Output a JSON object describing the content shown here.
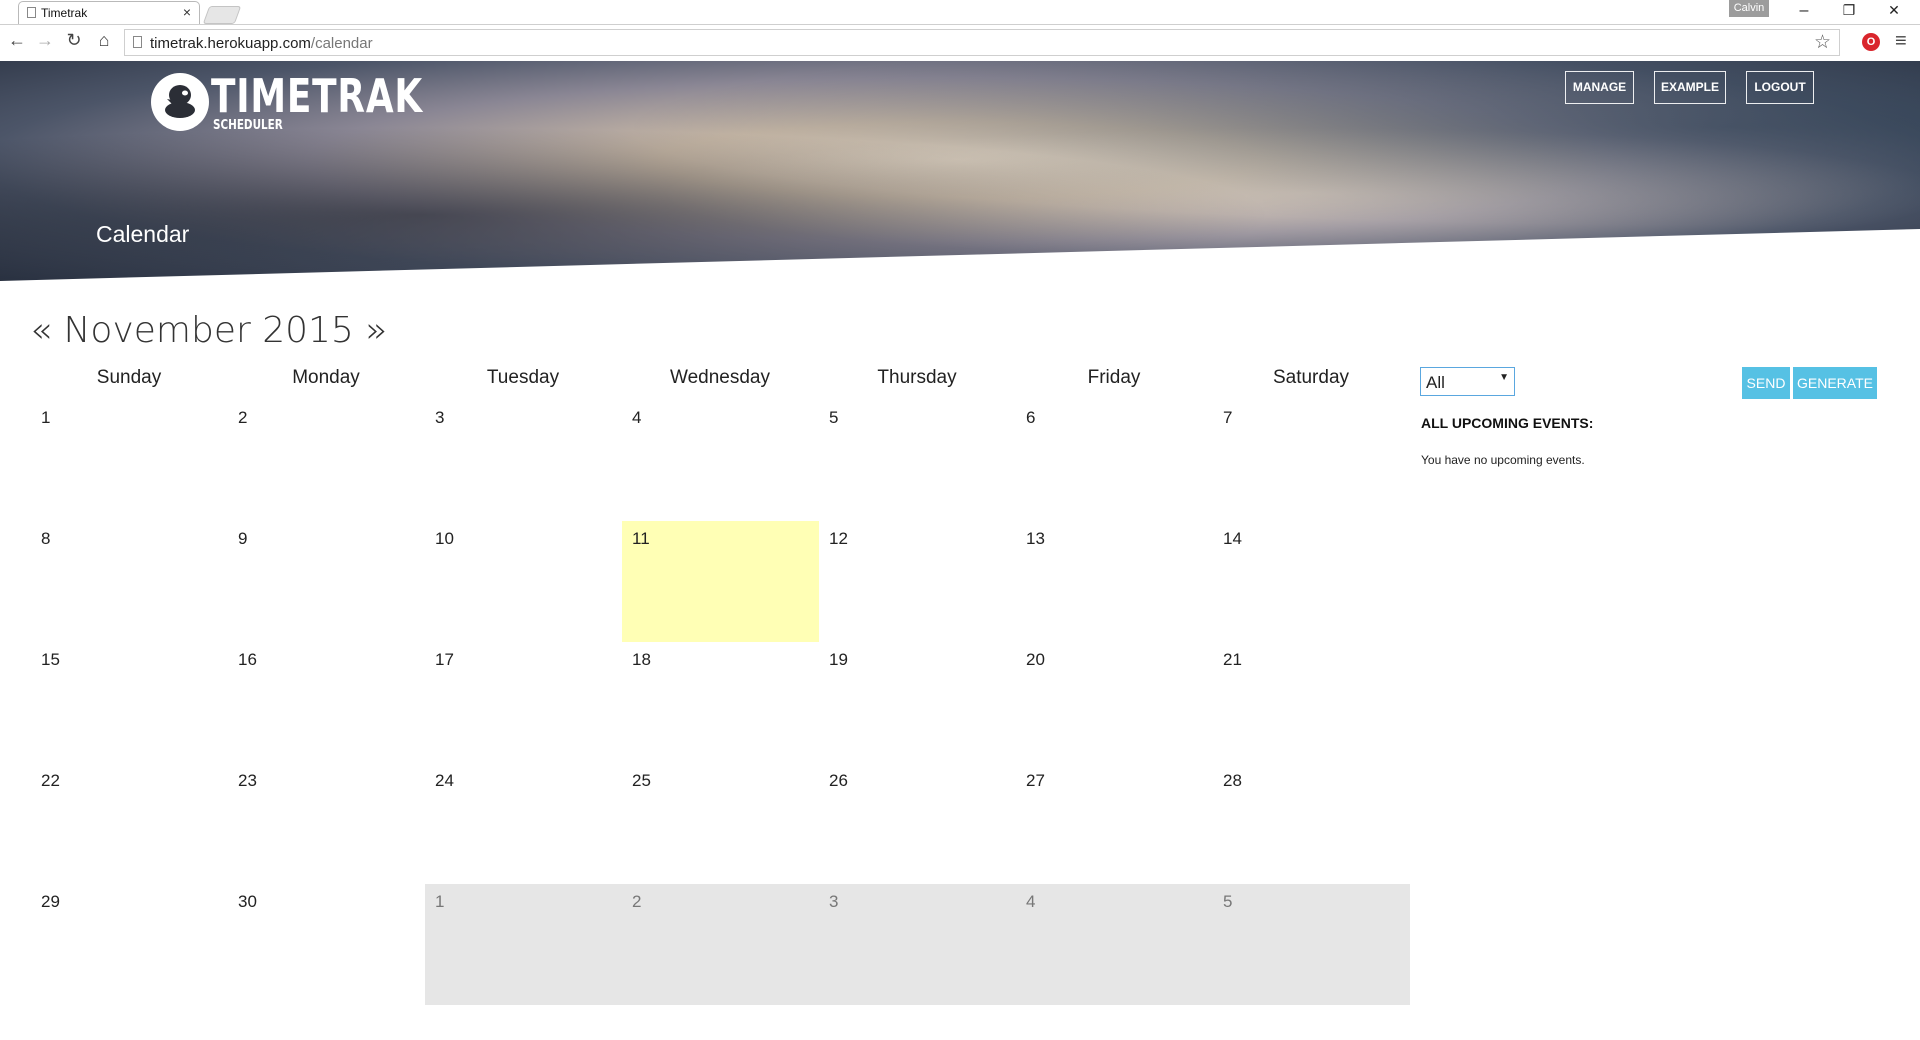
{
  "browser": {
    "tab_title": "Timetrak",
    "tab_close": "×",
    "profile_name": "Calvin",
    "url_host": "timetrak.herokuapp.com",
    "url_path": "/calendar",
    "minimize": "–",
    "restore": "❐",
    "close": "✕"
  },
  "header": {
    "logo_name": "TIMETRAK",
    "logo_sub": "SCHEDULER",
    "nav": [
      {
        "label": "MANAGE"
      },
      {
        "label": "EXAMPLE"
      },
      {
        "label": "LOGOUT"
      }
    ],
    "page_title": "Calendar"
  },
  "calendar": {
    "prev": "«",
    "month_label": "November 2015",
    "next": "»",
    "weekdays": [
      "Sunday",
      "Monday",
      "Tuesday",
      "Wednesday",
      "Thursday",
      "Friday",
      "Saturday"
    ],
    "weeks": [
      [
        "1",
        "2",
        "3",
        "4",
        "5",
        "6",
        "7"
      ],
      [
        "8",
        "9",
        "10",
        "11",
        "12",
        "13",
        "14"
      ],
      [
        "15",
        "16",
        "17",
        "18",
        "19",
        "20",
        "21"
      ],
      [
        "22",
        "23",
        "24",
        "25",
        "26",
        "27",
        "28"
      ],
      [
        "29",
        "30",
        "1",
        "2",
        "3",
        "4",
        "5"
      ]
    ],
    "today": "11",
    "today_color": "#ffffb5",
    "other_month_color": "#e6e6e6"
  },
  "sidebar": {
    "filter_value": "All",
    "send_label": "SEND",
    "generate_label": "GENERATE",
    "button_color": "#56c1e4",
    "upcoming_title": "ALL UPCOMING EVENTS:",
    "upcoming_empty": "You have no upcoming events."
  }
}
